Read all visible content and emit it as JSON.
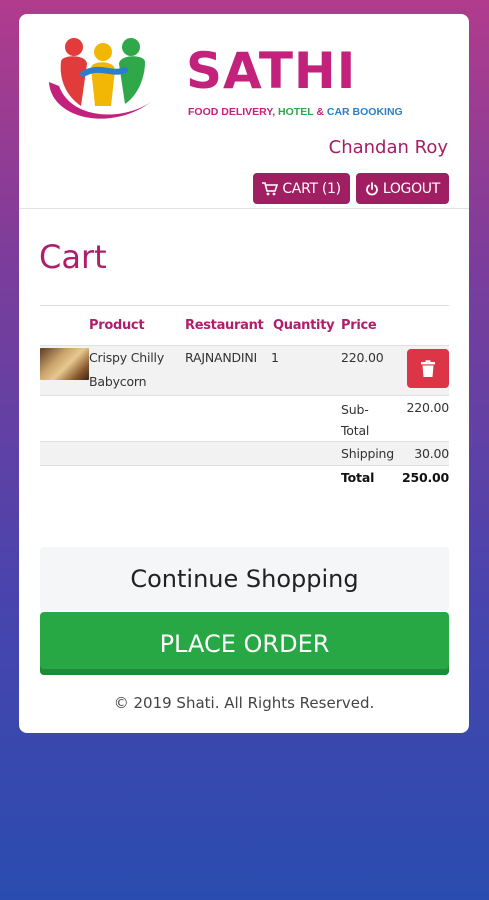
{
  "brand": {
    "name": "SATHI",
    "tagline_parts": [
      "FOOD DELIVERY, ",
      "HOTEL",
      " & ",
      "CAR BOOKING"
    ],
    "colors": {
      "primary": "#c2227c",
      "green": "#2fa84a",
      "blue": "#2a7fc8"
    }
  },
  "header": {
    "user_name": "Chandan Roy",
    "cart_label": "CART (1)",
    "logout_label": "LOGOUT",
    "cart_icon": "cart-icon",
    "logout_icon": "power-icon"
  },
  "page": {
    "title": "Cart"
  },
  "table": {
    "headers": [
      "Product",
      "Restaurant",
      "Quantity",
      "Price"
    ],
    "rows": [
      {
        "product_line1": "Crispy Chilly",
        "product_line2": "Babycorn",
        "restaurant": "RAJNANDINI",
        "quantity": "1",
        "price": "220.00"
      }
    ],
    "subtotal_label_1": "Sub-",
    "subtotal_label_2": "Total",
    "subtotal_value": "220.00",
    "shipping_label": "Shipping",
    "shipping_value": "30.00",
    "total_label": "Total",
    "total_value": "250.00"
  },
  "actions": {
    "continue_label": "Continue Shopping",
    "place_order_label": "PLACE ORDER",
    "place_order_color": "#28a745",
    "delete_color": "#dc3545"
  },
  "footer": {
    "text": "© 2019 Shati. All Rights Reserved."
  }
}
